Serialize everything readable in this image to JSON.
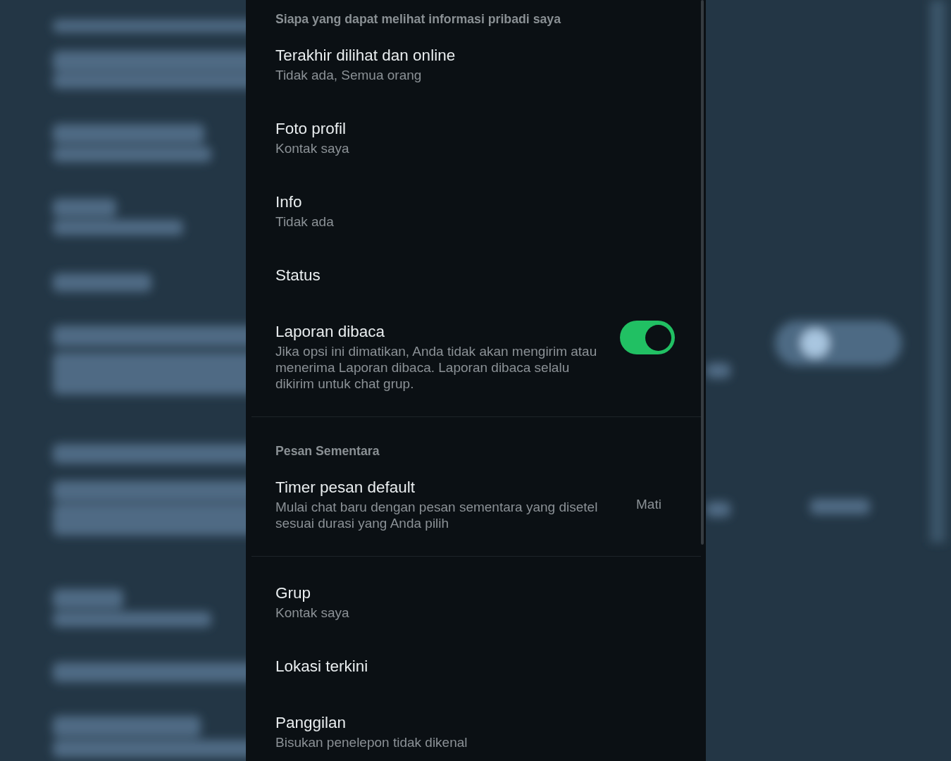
{
  "sections": [
    {
      "header": "Siapa yang dapat melihat informasi pribadi saya",
      "items": [
        {
          "kind": "link",
          "title": "Terakhir dilihat dan online",
          "subtitle": "Tidak ada, Semua orang"
        },
        {
          "kind": "link",
          "title": "Foto profil",
          "subtitle": "Kontak saya"
        },
        {
          "kind": "link",
          "title": "Info",
          "subtitle": "Tidak ada"
        },
        {
          "kind": "link",
          "title": "Status"
        },
        {
          "kind": "toggle",
          "title": "Laporan dibaca",
          "subtitle": "Jika opsi ini dimatikan, Anda tidak akan mengirim atau menerima Laporan dibaca. Laporan dibaca selalu dikirim untuk chat grup.",
          "on": true
        }
      ]
    },
    {
      "header": "Pesan Sementara",
      "items": [
        {
          "kind": "value",
          "title": "Timer pesan default",
          "subtitle": "Mulai chat baru dengan pesan sementara yang disetel sesuai durasi yang Anda pilih",
          "value": "Mati"
        }
      ]
    },
    {
      "items": [
        {
          "kind": "link",
          "title": "Grup",
          "subtitle": "Kontak saya"
        },
        {
          "kind": "link",
          "title": "Lokasi terkini"
        },
        {
          "kind": "link",
          "title": "Panggilan",
          "subtitle": "Bisukan penelepon tidak dikenal"
        }
      ]
    }
  ]
}
